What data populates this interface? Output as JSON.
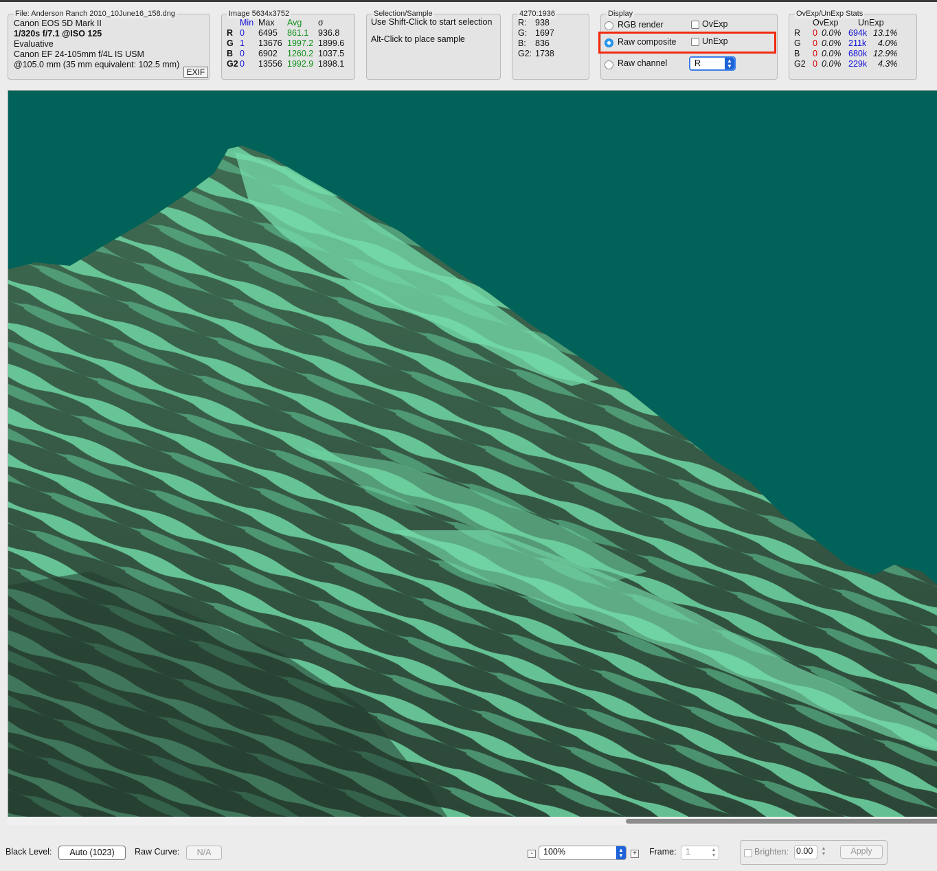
{
  "file_info": {
    "legend": "File: Anderson Ranch 2010_10June16_158.dng",
    "camera": "Canon EOS 5D Mark II",
    "exposure": "1/320s f/7.1 @ISO 125",
    "metering": "Evaluative",
    "lens": "Canon EF 24-105mm f/4L IS USM",
    "focal": "@105.0 mm (35 mm equivalent: 102.5 mm)",
    "exif_button": "EXIF"
  },
  "image_stats": {
    "legend": "Image 5634x3752",
    "headers": {
      "min": "Min",
      "max": "Max",
      "avg": "Avg",
      "sigma": "σ"
    },
    "rows": [
      {
        "ch": "R",
        "min": "0",
        "max": "6495",
        "avg": "861.1",
        "sigma": "936.8"
      },
      {
        "ch": "G",
        "min": "1",
        "max": "13676",
        "avg": "1997.2",
        "sigma": "1899.6"
      },
      {
        "ch": "B",
        "min": "0",
        "max": "6902",
        "avg": "1260.2",
        "sigma": "1037.5"
      },
      {
        "ch": "G2",
        "min": "0",
        "max": "13556",
        "avg": "1992.9",
        "sigma": "1898.1"
      }
    ]
  },
  "selection": {
    "legend": "Selection/Sample",
    "line1": "Use Shift-Click to start selection",
    "line2": "Alt-Click to place sample"
  },
  "sample": {
    "legend": "4270:1936",
    "rows": [
      {
        "label": "R:",
        "value": "938"
      },
      {
        "label": "G:",
        "value": "1697"
      },
      {
        "label": "B:",
        "value": "836"
      },
      {
        "label": "G2:",
        "value": "1738"
      }
    ]
  },
  "display": {
    "legend": "Display",
    "rgb_render": "RGB render",
    "raw_composite": "Raw composite",
    "raw_channel": "Raw channel",
    "ovexp": "OvExp",
    "unexp": "UnExp",
    "channel_select": "R",
    "selected_mode": "raw_composite",
    "highlight_color": "#f22a0e"
  },
  "ovexp_stats": {
    "legend": "OvExp/UnExp Stats",
    "headers": {
      "ovexp": "OvExp",
      "unexp": "UnExp"
    },
    "rows": [
      {
        "ch": "R",
        "ov_count": "0",
        "ov_pct": "0.0%",
        "un_count": "694k",
        "un_pct": "13.1%"
      },
      {
        "ch": "G",
        "ov_count": "0",
        "ov_pct": "0.0%",
        "un_count": "211k",
        "un_pct": "4.0%"
      },
      {
        "ch": "B",
        "ov_count": "0",
        "ov_pct": "0.0%",
        "un_count": "680k",
        "un_pct": "12.9%"
      },
      {
        "ch": "G2",
        "ov_count": "0",
        "ov_pct": "0.0%",
        "un_count": "229k",
        "un_pct": "4.3%"
      }
    ]
  },
  "bottom_bar": {
    "black_level_label": "Black Level:",
    "black_level_value": "Auto (1023)",
    "raw_curve_label": "Raw Curve:",
    "raw_curve_value": "N/A",
    "zoom_minus": "-",
    "zoom_value": "100%",
    "zoom_plus": "+",
    "frame_label": "Frame:",
    "frame_value": "1",
    "brighten_label": "Brighten:",
    "brighten_value": "0.00",
    "apply_label": "Apply"
  },
  "colors": {
    "sky": "#006258",
    "rock_dark": "#2e4d3c",
    "snow": "#6fd6a3"
  }
}
